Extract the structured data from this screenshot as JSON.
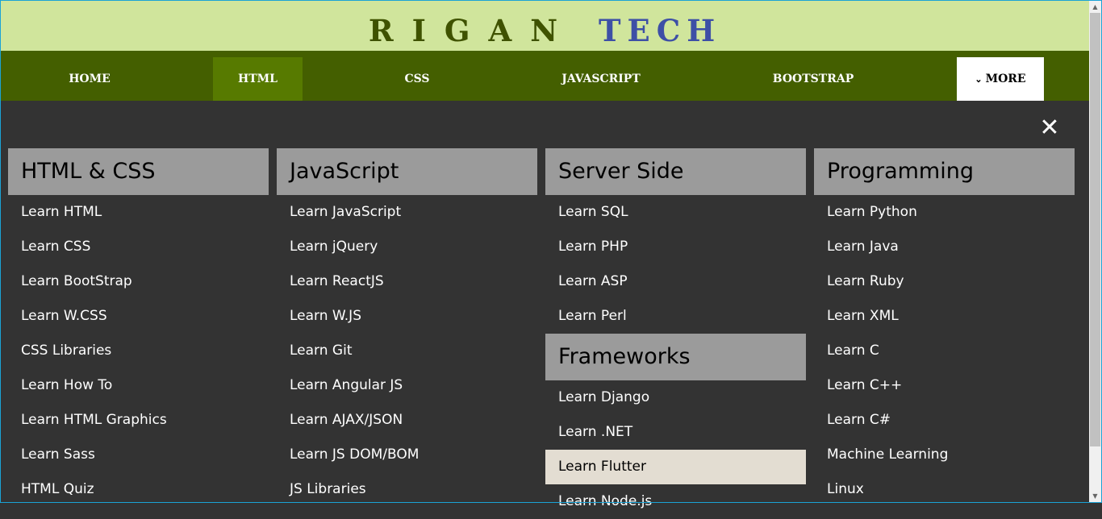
{
  "brand": {
    "part1": "RIGAN",
    "part2": "TECH"
  },
  "nav": {
    "home": "HOME",
    "html": "HTML",
    "css": "CSS",
    "javascript": "JAVASCRIPT",
    "bootstrap": "BOOTSTRAP",
    "more_chevron": "⌄",
    "more": "MORE"
  },
  "menu": {
    "close": "✕",
    "html_css": {
      "title": "HTML & CSS",
      "links": [
        "Learn HTML",
        "Learn CSS",
        "Learn BootStrap",
        "Learn W.CSS",
        "CSS Libraries",
        "Learn How To",
        "Learn HTML Graphics",
        "Learn Sass",
        "HTML Quiz"
      ]
    },
    "javascript": {
      "title": "JavaScript",
      "links": [
        "Learn JavaScript",
        "Learn jQuery",
        "Learn ReactJS",
        "Learn W.JS",
        "Learn Git",
        "Learn Angular JS",
        "Learn AJAX/JSON",
        "Learn JS DOM/BOM",
        "JS Libraries"
      ]
    },
    "server_side": {
      "title": "Server Side",
      "links": [
        "Learn SQL",
        "Learn PHP",
        "Learn ASP",
        "Learn Perl"
      ]
    },
    "frameworks": {
      "title": "Frameworks",
      "links": [
        "Learn Django",
        "Learn .NET",
        "Learn Flutter",
        "Learn Node.js"
      ]
    },
    "programming": {
      "title": "Programming",
      "links": [
        "Learn Python",
        "Learn Java",
        "Learn Ruby",
        "Learn XML",
        "Learn C",
        "Learn C++",
        "Learn C#",
        "Machine Learning",
        "Linux"
      ]
    }
  },
  "colors": {
    "header_bg": "#d0e59c",
    "nav_bg": "#445f00",
    "nav_active": "#577a00",
    "menu_bg": "#333333",
    "section_head": "#9b9b9b",
    "hover_row": "#e3ddd2"
  }
}
